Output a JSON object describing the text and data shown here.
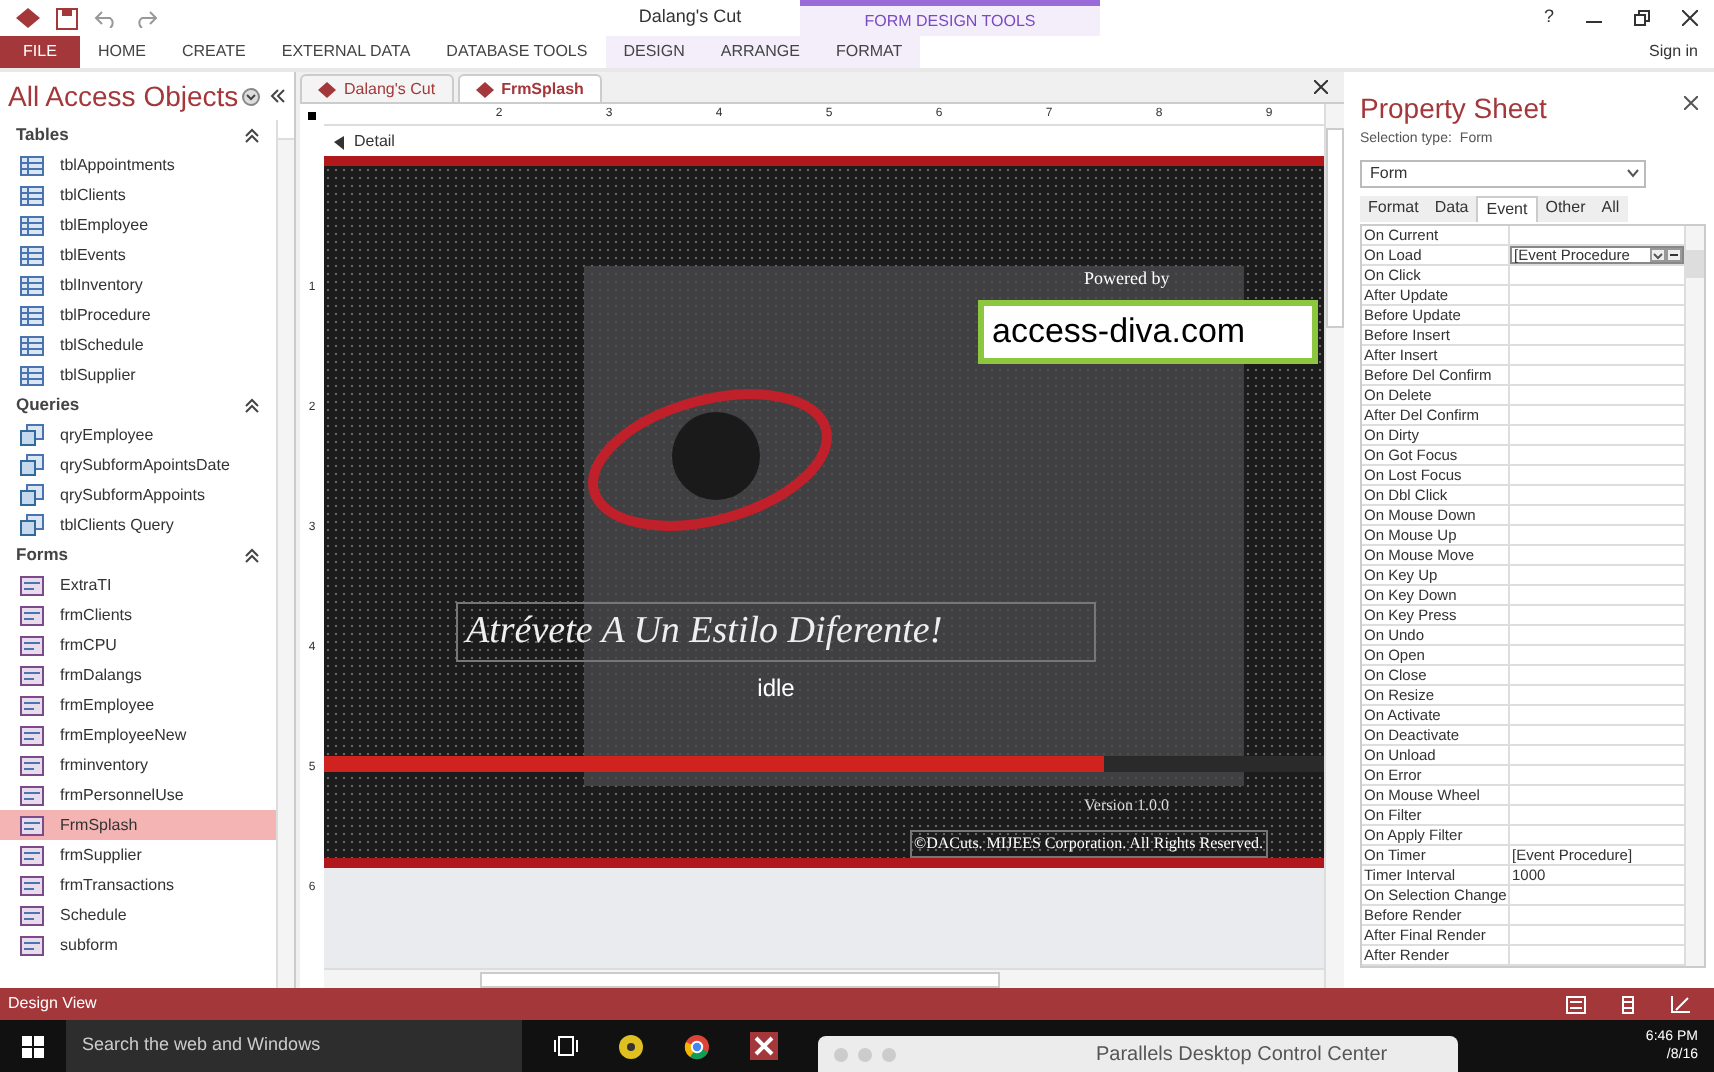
{
  "titlebar": {
    "title": "Dalang's Cut",
    "context_label": "FORM DESIGN TOOLS",
    "help": "?",
    "sign_in": "Sign in"
  },
  "ribbon_tabs": [
    {
      "label": "FILE",
      "selected": true,
      "context": false
    },
    {
      "label": "HOME",
      "selected": false,
      "context": false
    },
    {
      "label": "CREATE",
      "selected": false,
      "context": false
    },
    {
      "label": "EXTERNAL DATA",
      "selected": false,
      "context": false
    },
    {
      "label": "DATABASE TOOLS",
      "selected": false,
      "context": false
    },
    {
      "label": "DESIGN",
      "selected": false,
      "context": true
    },
    {
      "label": "ARRANGE",
      "selected": false,
      "context": true
    },
    {
      "label": "FORMAT",
      "selected": false,
      "context": true
    }
  ],
  "nav": {
    "title": "All Access Objects",
    "groups": [
      {
        "title": "Tables",
        "expanded": true,
        "items": [
          {
            "label": "tblAppointments",
            "kind": "table",
            "selected": false
          },
          {
            "label": "tblClients",
            "kind": "table",
            "selected": false
          },
          {
            "label": "tblEmployee",
            "kind": "table",
            "selected": false
          },
          {
            "label": "tblEvents",
            "kind": "table",
            "selected": false
          },
          {
            "label": "tblInventory",
            "kind": "table",
            "selected": false
          },
          {
            "label": "tblProcedure",
            "kind": "table",
            "selected": false
          },
          {
            "label": "tblSchedule",
            "kind": "table",
            "selected": false
          },
          {
            "label": "tblSupplier",
            "kind": "table",
            "selected": false
          }
        ]
      },
      {
        "title": "Queries",
        "expanded": true,
        "items": [
          {
            "label": "qryEmployee",
            "kind": "query",
            "selected": false
          },
          {
            "label": "qrySubformApointsDate",
            "kind": "query",
            "selected": false
          },
          {
            "label": "qrySubformAppoints",
            "kind": "query",
            "selected": false
          },
          {
            "label": "tblClients Query",
            "kind": "query",
            "selected": false
          }
        ]
      },
      {
        "title": "Forms",
        "expanded": true,
        "items": [
          {
            "label": "ExtraTI",
            "kind": "form",
            "selected": false
          },
          {
            "label": "frmClients",
            "kind": "form",
            "selected": false
          },
          {
            "label": "frmCPU",
            "kind": "form",
            "selected": false
          },
          {
            "label": "frmDalangs",
            "kind": "form",
            "selected": false
          },
          {
            "label": "frmEmployee",
            "kind": "form",
            "selected": false
          },
          {
            "label": "frmEmployeeNew",
            "kind": "form",
            "selected": false
          },
          {
            "label": "frminventory",
            "kind": "form",
            "selected": false
          },
          {
            "label": "frmPersonnelUse",
            "kind": "form",
            "selected": false
          },
          {
            "label": "FrmSplash",
            "kind": "form",
            "selected": true
          },
          {
            "label": "frmSupplier",
            "kind": "form",
            "selected": false
          },
          {
            "label": "frmTransactions",
            "kind": "form",
            "selected": false
          },
          {
            "label": "Schedule",
            "kind": "form",
            "selected": false
          },
          {
            "label": "subform",
            "kind": "form",
            "selected": false
          }
        ]
      }
    ]
  },
  "doc_tabs": [
    {
      "label": "Dalang's Cut",
      "selected": false
    },
    {
      "label": "FrmSplash",
      "selected": true
    }
  ],
  "ruler": {
    "horizontal": [
      "2",
      "3",
      "4",
      "5",
      "6",
      "7",
      "8",
      "9"
    ],
    "vertical": [
      "1",
      "2",
      "3",
      "4",
      "5",
      "6"
    ]
  },
  "section": "Detail",
  "splash": {
    "powered_by": "Powered by",
    "logo_text": "access-diva.com",
    "slogan": "Atrévete A Un Estilo Diferente!",
    "status": "idle",
    "progress": {
      "level": 0.78
    },
    "version": "Version 1.0.0",
    "copyright": "©DACuts. MIJEES Corporation. All Rights Reserved."
  },
  "property_sheet": {
    "title": "Property Sheet",
    "selection_label": "Selection type:",
    "selection_type": "Form",
    "object": "Form",
    "tabs": [
      {
        "label": "Format",
        "selected": false
      },
      {
        "label": "Data",
        "selected": false
      },
      {
        "label": "Event",
        "selected": true
      },
      {
        "label": "Other",
        "selected": false
      },
      {
        "label": "All",
        "selected": false
      }
    ],
    "rows": [
      {
        "name": "On Current"
      },
      {
        "name": "On Load",
        "value": "[Event Procedure",
        "selected": true
      },
      {
        "name": "On Click"
      },
      {
        "name": "After Update"
      },
      {
        "name": "Before Update"
      },
      {
        "name": "Before Insert"
      },
      {
        "name": "After Insert"
      },
      {
        "name": "Before Del Confirm"
      },
      {
        "name": "On Delete"
      },
      {
        "name": "After Del Confirm"
      },
      {
        "name": "On Dirty"
      },
      {
        "name": "On Got Focus"
      },
      {
        "name": "On Lost Focus"
      },
      {
        "name": "On Dbl Click"
      },
      {
        "name": "On Mouse Down"
      },
      {
        "name": "On Mouse Up"
      },
      {
        "name": "On Mouse Move"
      },
      {
        "name": "On Key Up"
      },
      {
        "name": "On Key Down"
      },
      {
        "name": "On Key Press"
      },
      {
        "name": "On Undo"
      },
      {
        "name": "On Open"
      },
      {
        "name": "On Close"
      },
      {
        "name": "On Resize"
      },
      {
        "name": "On Activate"
      },
      {
        "name": "On Deactivate"
      },
      {
        "name": "On Unload"
      },
      {
        "name": "On Error"
      },
      {
        "name": "On Mouse Wheel"
      },
      {
        "name": "On Filter"
      },
      {
        "name": "On Apply Filter"
      },
      {
        "name": "On Timer",
        "value": "[Event Procedure]"
      },
      {
        "name": "Timer Interval",
        "value": "1000"
      },
      {
        "name": "On Selection Change"
      },
      {
        "name": "Before Render"
      },
      {
        "name": "After Final Render"
      },
      {
        "name": "After Render"
      }
    ]
  },
  "status_bar": {
    "text": "Design View"
  },
  "taskbar": {
    "search_placeholder": "Search the web and Windows",
    "window_title": "Parallels Desktop Control Center",
    "time": "6:46 PM",
    "date": "/8/16"
  }
}
